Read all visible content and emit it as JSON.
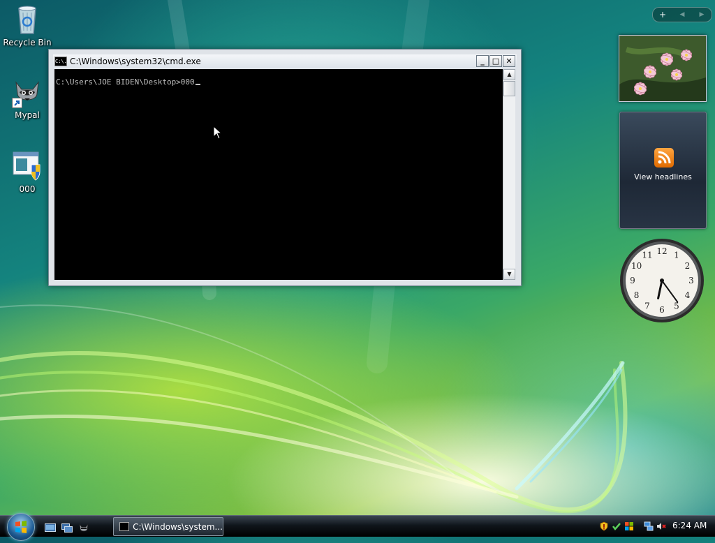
{
  "desktop": {
    "icons": [
      {
        "label": "Recycle Bin",
        "icon": "recycle-bin-icon"
      },
      {
        "label": "Mypal",
        "icon": "raccoon-icon"
      },
      {
        "label": "000",
        "icon": "program-shield-icon"
      }
    ]
  },
  "cmd": {
    "title": "C:\\Windows\\system32\\cmd.exe",
    "icon_text": "C:\\.",
    "minimize": "_",
    "maximize": "□",
    "close": "✕",
    "prompt": "C:\\Users\\JOE BIDEN\\Desktop>000",
    "scroll_up": "▲",
    "scroll_down": "▼"
  },
  "sidebar": {
    "add_gadget": "+",
    "prev": "◀",
    "next": "▶",
    "feed_label": "View headlines",
    "clock": {
      "hour": 6,
      "minute": 24
    },
    "clock_numbers": [
      "12",
      "1",
      "2",
      "3",
      "4",
      "5",
      "6",
      "7",
      "8",
      "9",
      "10",
      "11"
    ]
  },
  "taskbar": {
    "task_button_label": "C:\\Windows\\system...",
    "time": "6:24 AM"
  },
  "colors": {
    "titlebar": "#dde3ea",
    "console_bg": "#000000",
    "console_fg": "#c0c0c0",
    "rss_orange": "#f08a1c"
  }
}
